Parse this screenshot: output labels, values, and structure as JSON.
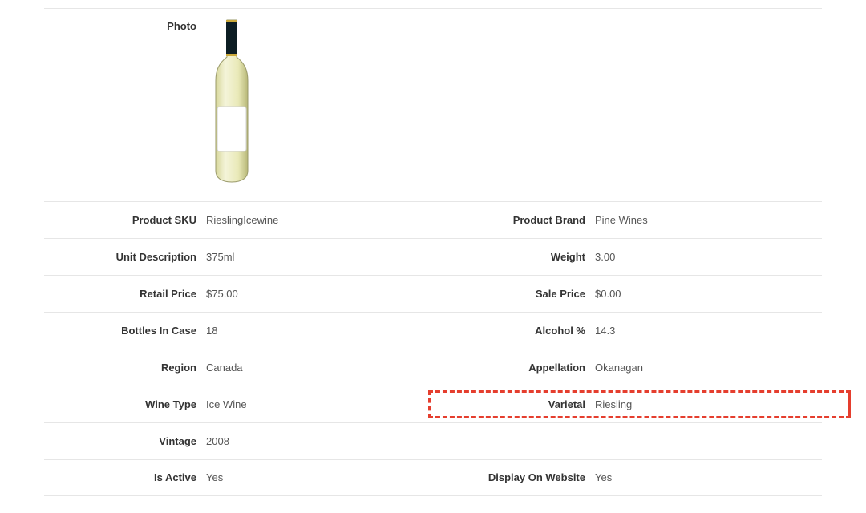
{
  "photo_label": "Photo",
  "left": [
    {
      "label": "Product SKU",
      "value": "RieslingIcewine"
    },
    {
      "label": "Unit Description",
      "value": "375ml"
    },
    {
      "label": "Retail Price",
      "value": "$75.00"
    },
    {
      "label": "Bottles In Case",
      "value": "18"
    },
    {
      "label": "Region",
      "value": "Canada"
    },
    {
      "label": "Wine Type",
      "value": "Ice Wine"
    },
    {
      "label": "Vintage",
      "value": "2008"
    },
    {
      "label": "Is Active",
      "value": "Yes"
    }
  ],
  "right": [
    {
      "label": "Product Brand",
      "value": "Pine Wines"
    },
    {
      "label": "Weight",
      "value": "3.00"
    },
    {
      "label": "Sale Price",
      "value": "$0.00"
    },
    {
      "label": "Alcohol %",
      "value": "14.3"
    },
    {
      "label": "Appellation",
      "value": "Okanagan"
    },
    {
      "label": "Varietal",
      "value": "Riesling",
      "highlight": true
    },
    null,
    {
      "label": "Display On Website",
      "value": "Yes"
    }
  ]
}
